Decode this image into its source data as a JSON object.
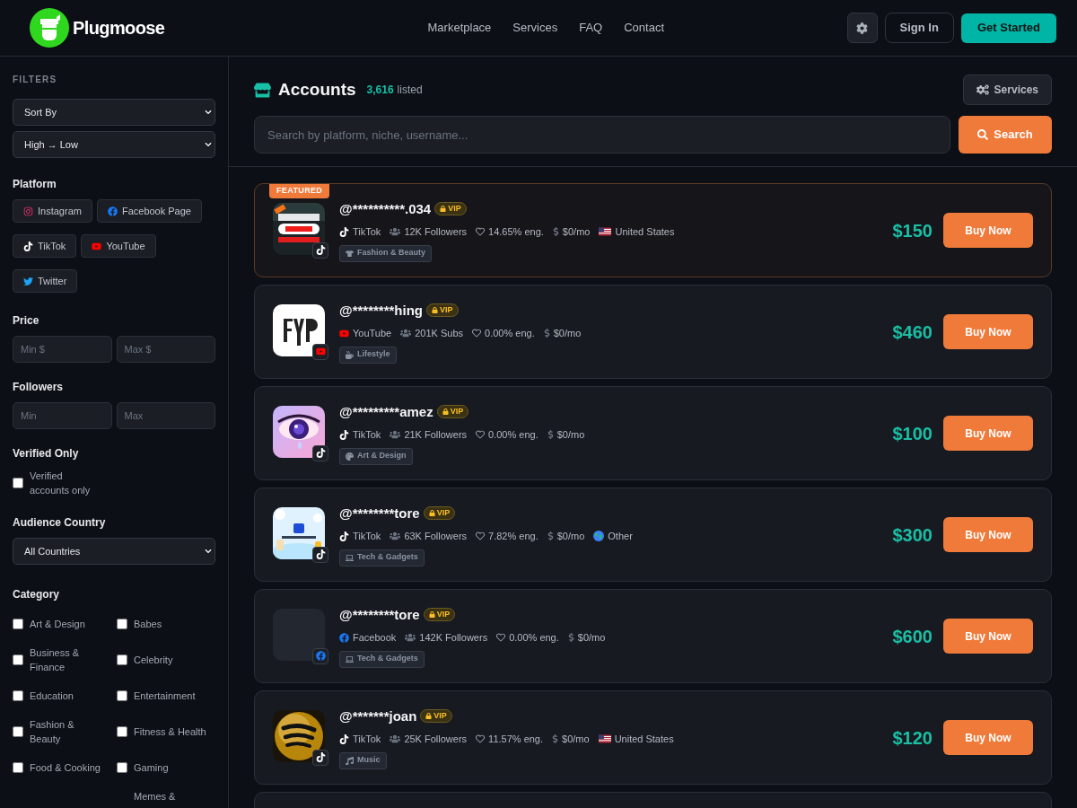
{
  "brand": {
    "name": "Plugmoose"
  },
  "nav": [
    "Marketplace",
    "Services",
    "FAQ",
    "Contact"
  ],
  "header_buttons": {
    "sign_in": "Sign In",
    "get_started": "Get Started"
  },
  "filters": {
    "title": "FILTERS",
    "sort_by": "Sort By",
    "order": "High → Low",
    "platform": {
      "title": "Platform",
      "options": [
        {
          "label": "Instagram",
          "kind": "instagram",
          "selected": false
        },
        {
          "label": "Facebook Page",
          "kind": "facebook",
          "selected": false
        },
        {
          "label": "TikTok",
          "kind": "tiktok",
          "selected": false
        },
        {
          "label": "YouTube",
          "kind": "youtube",
          "selected": false
        },
        {
          "label": "Twitter",
          "kind": "twitter",
          "selected": false
        }
      ]
    },
    "price": {
      "title": "Price",
      "min_placeholder": "Min $",
      "max_placeholder": "Max $"
    },
    "followers": {
      "title": "Followers",
      "min_placeholder": "Min",
      "max_placeholder": "Max"
    },
    "verified": {
      "title": "Verified Only",
      "label": "Verified accounts only",
      "checked": false
    },
    "country": {
      "title": "Audience Country",
      "value": "All Countries"
    },
    "category": {
      "title": "Category",
      "items": [
        {
          "label": "Art & Design",
          "checked": false
        },
        {
          "label": "Babes",
          "checked": false
        },
        {
          "label": "Business & Finance",
          "checked": false
        },
        {
          "label": "Celebrity",
          "checked": false
        },
        {
          "label": "Education",
          "checked": false
        },
        {
          "label": "Entertainment",
          "checked": false
        },
        {
          "label": "Fashion & Beauty",
          "checked": false
        },
        {
          "label": "Fitness & Health",
          "checked": false
        },
        {
          "label": "Food & Cooking",
          "checked": false
        },
        {
          "label": "Gaming",
          "checked": false
        }
      ],
      "cut_off_item": "Memes &"
    }
  },
  "main": {
    "title": "Accounts",
    "count": "3,616",
    "count_suffix": "listed",
    "services_button": "Services",
    "search": {
      "placeholder": "Search by platform, niche, username...",
      "button": "Search"
    }
  },
  "listings": [
    {
      "featured": true,
      "badge": "FEATURED",
      "handle": "@**********.034",
      "vip": "VIP",
      "platform": {
        "kind": "tiktok",
        "label": "TikTok"
      },
      "audience": "12K Followers",
      "engagement": "14.65% eng.",
      "monthly": "$0/mo",
      "country": {
        "kind": "us",
        "label": "United States"
      },
      "tag": {
        "kind": "fashion",
        "label": "Fashion & Beauty"
      },
      "price": "$150",
      "buy": "Buy Now"
    },
    {
      "featured": false,
      "handle": "@********hing",
      "vip": "VIP",
      "platform": {
        "kind": "youtube",
        "label": "YouTube"
      },
      "audience": "201K Subs",
      "engagement": "0.00% eng.",
      "monthly": "$0/mo",
      "tag": {
        "kind": "lifestyle",
        "label": "Lifestyle"
      },
      "price": "$460",
      "buy": "Buy Now"
    },
    {
      "featured": false,
      "handle": "@*********amez",
      "vip": "VIP",
      "platform": {
        "kind": "tiktok",
        "label": "TikTok"
      },
      "audience": "21K Followers",
      "engagement": "0.00% eng.",
      "monthly": "$0/mo",
      "tag": {
        "kind": "art",
        "label": "Art & Design"
      },
      "price": "$100",
      "buy": "Buy Now"
    },
    {
      "featured": false,
      "handle": "@********tore",
      "vip": "VIP",
      "platform": {
        "kind": "tiktok",
        "label": "TikTok"
      },
      "audience": "63K Followers",
      "engagement": "7.82% eng.",
      "monthly": "$0/mo",
      "country": {
        "kind": "globe",
        "label": "Other"
      },
      "tag": {
        "kind": "tech",
        "label": "Tech & Gadgets"
      },
      "price": "$300",
      "buy": "Buy Now"
    },
    {
      "featured": false,
      "avatar": {
        "kind": "empty"
      },
      "handle": "@********tore",
      "vip": "VIP",
      "platform": {
        "kind": "facebook",
        "label": "Facebook"
      },
      "audience": "142K Followers",
      "engagement": "0.00% eng.",
      "monthly": "$0/mo",
      "tag": {
        "kind": "tech",
        "label": "Tech & Gadgets"
      },
      "price": "$600",
      "buy": "Buy Now"
    },
    {
      "featured": false,
      "handle": "@*******joan",
      "vip": "VIP",
      "platform": {
        "kind": "tiktok",
        "label": "TikTok"
      },
      "audience": "25K Followers",
      "engagement": "11.57% eng.",
      "monthly": "$0/mo",
      "country": {
        "kind": "us",
        "label": "United States"
      },
      "tag": {
        "kind": "music",
        "label": "Music"
      },
      "price": "$120",
      "buy": "Buy Now"
    }
  ]
}
